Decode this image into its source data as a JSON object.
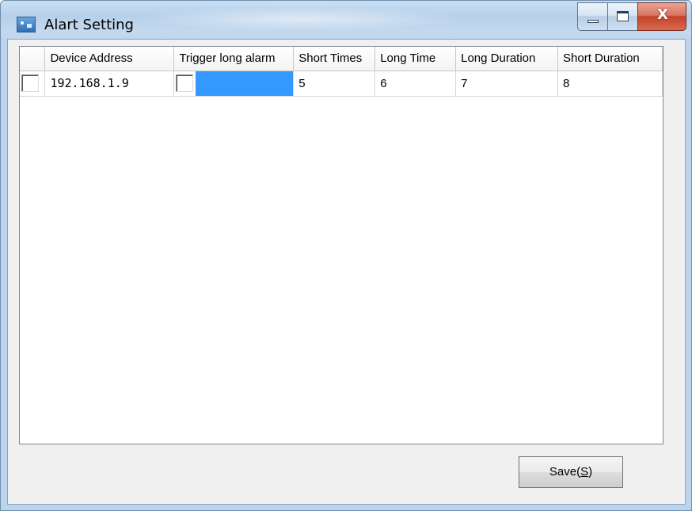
{
  "window": {
    "title": "Alart Setting",
    "controls": {
      "minimize": "minimize",
      "maximize": "maximize",
      "close": "X"
    }
  },
  "table": {
    "columns": [
      "",
      "Device Address",
      "Trigger long alarm",
      "Short Times",
      "Long Time",
      "Long Duration",
      "Short Duration"
    ],
    "rows": [
      {
        "selected": false,
        "device_address": "192.168.1.9",
        "trigger_long_alarm": false,
        "short_times": "5",
        "long_time": "6",
        "long_duration": "7",
        "short_duration": "8"
      }
    ]
  },
  "save_button": {
    "prefix": "Save(",
    "mnemonic": "S",
    "suffix": ")"
  },
  "colors": {
    "selection_highlight": "#3399ff",
    "close_button": "#c24329",
    "title_bar": "#bcd4ec"
  },
  "icons": {
    "app": "app-icon",
    "close": "close-icon",
    "minimize": "minimize-icon",
    "maximize": "maximize-icon"
  }
}
